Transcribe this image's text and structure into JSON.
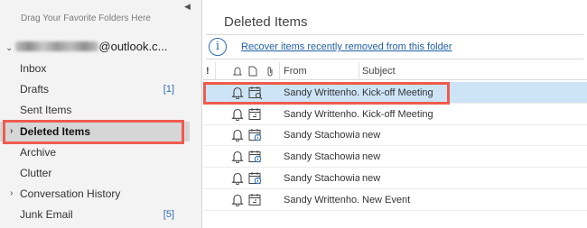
{
  "folder_pane": {
    "favorites_hint": "Drag Your Favorite Folders Here",
    "account_suffix": "@outlook.c...",
    "folders": [
      {
        "label": "Inbox",
        "count": ""
      },
      {
        "label": "Drafts",
        "count": "[1]"
      },
      {
        "label": "Sent Items",
        "count": ""
      },
      {
        "label": "Deleted Items",
        "count": "",
        "selected": true
      },
      {
        "label": "Archive",
        "count": ""
      },
      {
        "label": "Clutter",
        "count": ""
      },
      {
        "label": "Conversation History",
        "count": ""
      },
      {
        "label": "Junk Email",
        "count": "[5]"
      }
    ]
  },
  "message_pane": {
    "title": "Deleted Items",
    "recover_link": "Recover items recently removed from this folder",
    "columns": {
      "importance": "!",
      "from": "From",
      "subject": "Subject"
    },
    "rows": [
      {
        "from": "Sandy Writtenho...",
        "subject": "Kick-off Meeting",
        "icon": "meeting-request-icon",
        "selected": true
      },
      {
        "from": "Sandy Writtenho...",
        "subject": "Kick-off Meeting",
        "icon": "calendar-icon"
      },
      {
        "from": "Sandy Stachowiak",
        "subject": "new",
        "icon": "calendar-info-icon"
      },
      {
        "from": "Sandy Stachowiak",
        "subject": "new",
        "icon": "calendar-info-icon"
      },
      {
        "from": "Sandy Stachowiak",
        "subject": "new",
        "icon": "calendar-info-icon"
      },
      {
        "from": "Sandy Writtenho...",
        "subject": "New Event",
        "icon": "calendar-icon"
      }
    ]
  },
  "colors": {
    "highlight": "#ee5b4e",
    "link": "#1f5fa8",
    "selected_row": "#cde4f7"
  }
}
